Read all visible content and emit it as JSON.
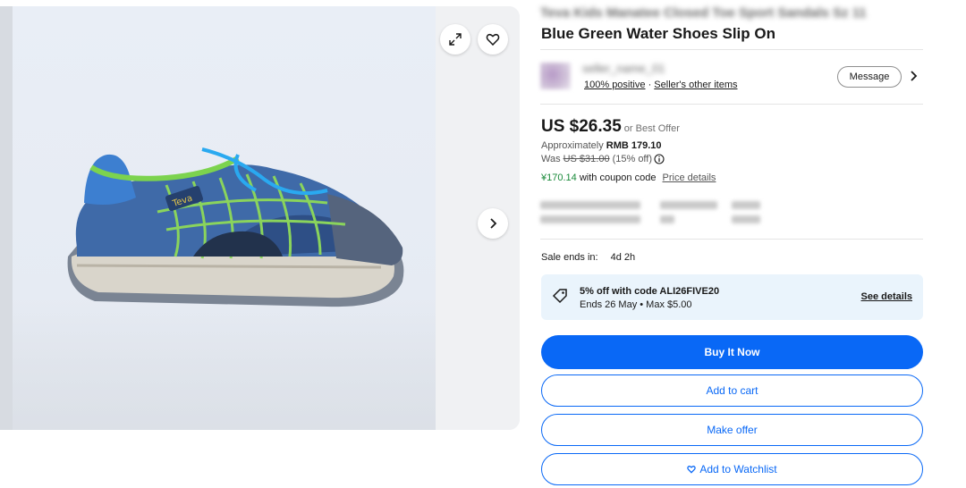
{
  "listing": {
    "title_line1_blurred": "Teva Kids Manatee Closed Toe Sport Sandals Sz 11",
    "title_line2": "Blue Green Water Shoes Slip On"
  },
  "seller": {
    "name_blurred": "seller_name_01",
    "feedback": "100% positive",
    "separator": "·",
    "other_items": "Seller's other items",
    "message_label": "Message"
  },
  "pricing": {
    "price": "US $26.35",
    "best_offer": "or Best Offer",
    "approx_prefix": "Approximately",
    "approx_value": "RMB 179.10",
    "was_prefix": "Was",
    "was_price": "US $31.00",
    "discount": "(15% off)",
    "coupon_amount": "¥170.14",
    "coupon_text": "with coupon code",
    "price_details": "Price details"
  },
  "sale": {
    "label": "Sale ends in:",
    "value": "4d 2h"
  },
  "promo": {
    "line1": "5% off with code ALI26FIVE20",
    "line2": "Ends 26 May • Max $5.00",
    "see_details": "See details"
  },
  "actions": {
    "buy_now": "Buy It Now",
    "add_to_cart": "Add to cart",
    "make_offer": "Make offer",
    "add_to_watchlist": "Add to Watchlist"
  },
  "colors": {
    "primary_blue": "#0968f6",
    "coupon_green": "#1a8a3a",
    "promo_bg": "#eaf4fc"
  },
  "icons": [
    "expand-icon",
    "heart-icon",
    "chevron-right-icon",
    "info-icon",
    "tag-icon"
  ]
}
